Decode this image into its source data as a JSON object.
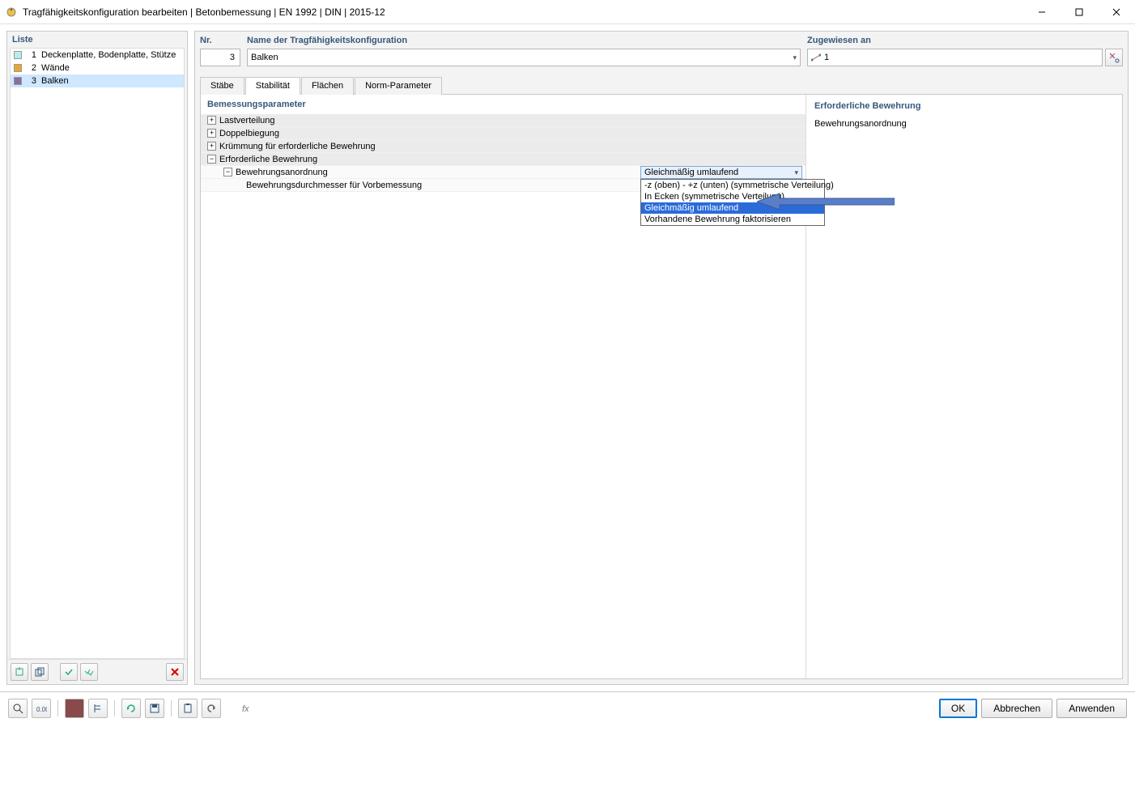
{
  "window": {
    "title": "Tragfähigkeitskonfiguration bearbeiten | Betonbemessung | EN 1992 | DIN | 2015-12"
  },
  "left": {
    "header": "Liste",
    "items": [
      {
        "num": "1",
        "label": "Deckenplatte, Bodenplatte, Stütze",
        "color": "#b6ecec"
      },
      {
        "num": "2",
        "label": "Wände",
        "color": "#e8a72e"
      },
      {
        "num": "3",
        "label": "Balken",
        "color": "#8a6fa0"
      }
    ]
  },
  "top": {
    "nr_label": "Nr.",
    "nr_value": "3",
    "name_label": "Name der Tragfähigkeitskonfiguration",
    "name_value": "Balken",
    "zug_label": "Zugewiesen an",
    "zug_value": "1"
  },
  "tabs": [
    "Stäbe",
    "Stabilität",
    "Flächen",
    "Norm-Parameter"
  ],
  "params": {
    "header": "Bemessungsparameter",
    "rows": [
      "Lastverteilung",
      "Doppelbiegung",
      "Krümmung für erforderliche Bewehrung",
      "Erforderliche Bewehrung"
    ],
    "sub1": "Bewehrungsanordnung",
    "sub2": "Bewehrungsdurchmesser für Vorbemessung",
    "dd_selected": "Gleichmäßig umlaufend",
    "dd_items": [
      "-z (oben) - +z (unten) (symmetrische Verteilung)",
      "In Ecken (symmetrische Verteilung)",
      "Gleichmäßig umlaufend",
      "Vorhandene Bewehrung faktorisieren"
    ]
  },
  "right": {
    "title": "Erforderliche Bewehrung",
    "text": "Bewehrungsanordnung"
  },
  "buttons": {
    "ok": "OK",
    "cancel": "Abbrechen",
    "apply": "Anwenden"
  }
}
